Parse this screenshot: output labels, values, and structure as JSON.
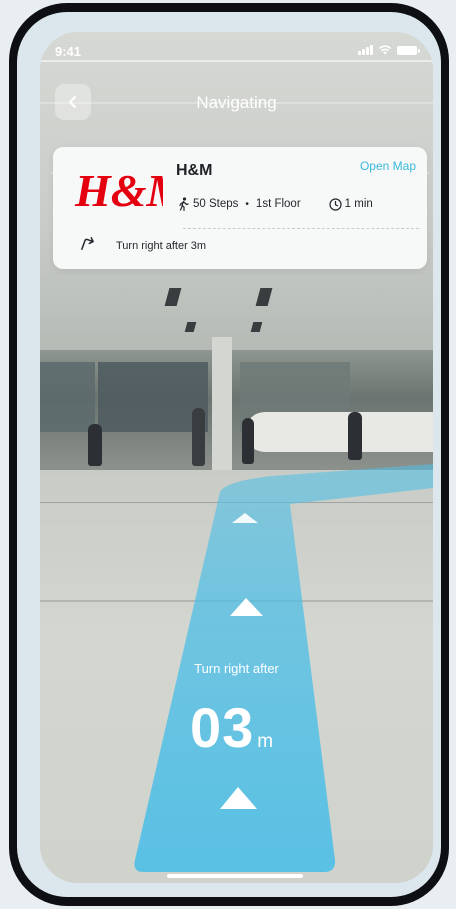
{
  "status_bar": {
    "time": "9:41"
  },
  "header": {
    "title": "Navigating",
    "back_icon": "chevron-left-icon"
  },
  "destination_card": {
    "brand_logo_text": "H&M",
    "brand_name": "H&M",
    "open_map_label": "Open Map",
    "steps": "50 Steps",
    "floor": "1st Floor",
    "separator": "•",
    "time": "1 min",
    "instruction": "Turn right after 3m",
    "colors": {
      "brand_red": "#e50010",
      "link_blue": "#3ab8de"
    }
  },
  "guidance": {
    "label": "Turn right after",
    "distance_value": "03",
    "distance_unit": "m",
    "path_color": "#4fbfe6"
  }
}
